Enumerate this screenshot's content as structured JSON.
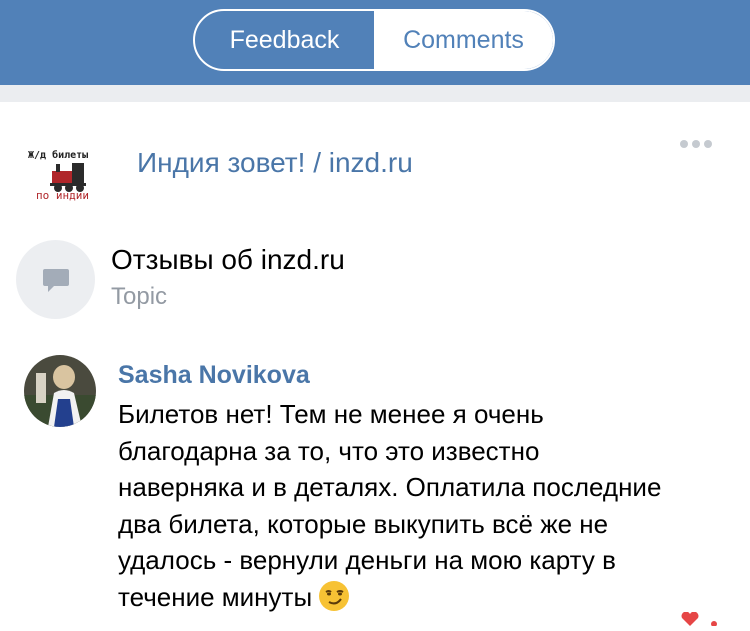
{
  "tabs": {
    "feedback": "Feedback",
    "comments": "Comments"
  },
  "group": {
    "name": "Индия зовет! / inzd.ru",
    "logo_line1": "Ж/д билеты",
    "logo_line2": "по индии"
  },
  "topic": {
    "title": "Отзывы об inzd.ru",
    "subtitle": "Topic"
  },
  "comment": {
    "author": "Sasha Novikova",
    "lines": [
      "Билетов нет! Тем не менее я очень",
      "благодарна за то, что это известно",
      "наверняка и в деталях. Оплатила последние",
      "два билета, которые выкупить всё же не",
      "удалось - вернули деньги на мою карту в",
      "течение минуты"
    ]
  },
  "colors": {
    "header": "#5181b8",
    "link": "#4a76a8",
    "muted": "#939aa3",
    "band": "#ebedf0"
  },
  "icons": [
    "more-dots-icon",
    "topic-bubble-icon",
    "smirk-emoji-icon",
    "heart-icon",
    "train-icon"
  ]
}
